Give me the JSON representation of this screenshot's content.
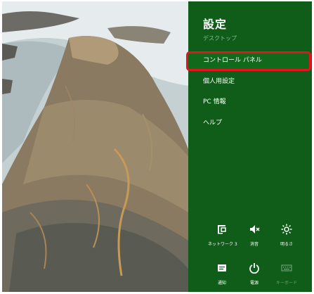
{
  "charm": {
    "title": "設定",
    "menu": [
      {
        "label": "デスクトップ",
        "state": "dimmed"
      },
      {
        "label": "コントロール パネル",
        "state": "selected-highlighted"
      },
      {
        "label": "個人用設定",
        "state": "normal"
      },
      {
        "label": "PC 情報",
        "state": "normal"
      },
      {
        "label": "ヘルプ",
        "state": "normal"
      }
    ],
    "quick_settings": [
      {
        "label": "ネットワーク 3",
        "icon": "network-icon"
      },
      {
        "label": "消音",
        "icon": "speaker-mute-icon"
      },
      {
        "label": "明るさ",
        "icon": "brightness-icon"
      },
      {
        "label": "通知",
        "icon": "notifications-icon"
      },
      {
        "label": "電源",
        "icon": "power-icon"
      },
      {
        "label": "キーボード",
        "icon": "keyboard-icon"
      }
    ]
  },
  "colors": {
    "panel": "#0f5d18",
    "highlight_border": "#e3141d"
  }
}
